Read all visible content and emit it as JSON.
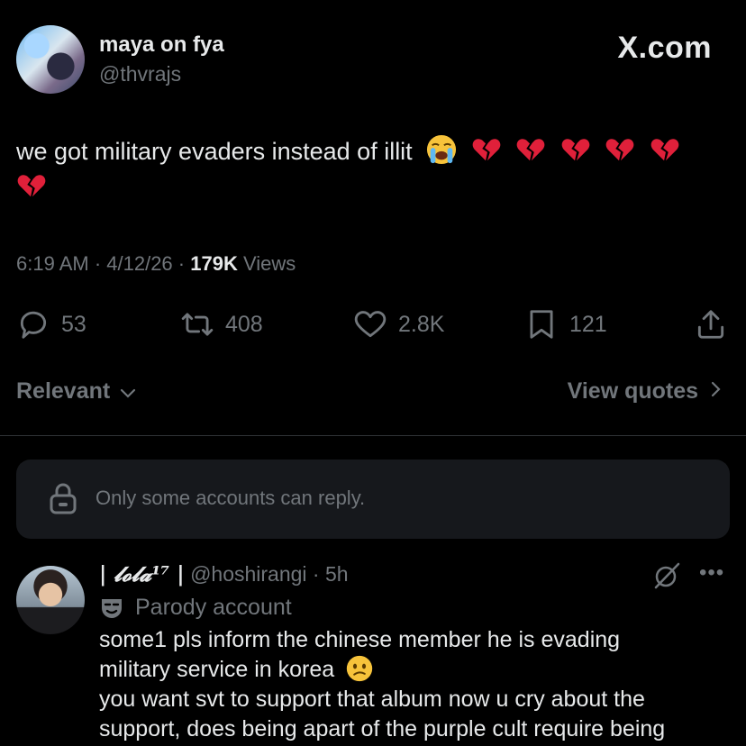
{
  "watermark": "X.com",
  "post": {
    "display_name": "maya on fya",
    "handle": "@thvrajs",
    "text": "we got military evaders instead of illit",
    "emojis": [
      "loudly-crying-face",
      "broken-heart",
      "broken-heart",
      "broken-heart",
      "broken-heart",
      "broken-heart",
      "broken-heart"
    ],
    "time": "6:19 AM · 4/12/26 · ",
    "views_count": "179K",
    "views_label": "Views",
    "stats": {
      "replies": "53",
      "reposts": "408",
      "likes": "2.8K",
      "bookmarks": "121"
    }
  },
  "filters": {
    "sort_label": "Relevant",
    "view_quotes_label": "View quotes"
  },
  "reply_restriction": "Only some accounts can reply.",
  "reply": {
    "display_name": "| 𝓵𝓸𝓵𝓪¹⁷ |",
    "handle_time": "@hoshirangi · 5h",
    "badge_label": "Parody account",
    "line1": "some1 pls inform the chinese member he is evading",
    "line2": "military service in korea",
    "line3": "you want svt to support that album now u cry about the",
    "line4": "support, does being apart of the purple cult require being"
  },
  "colors": {
    "background": "#000000",
    "text_primary": "#e7e9ea",
    "text_secondary": "#71767b",
    "divider": "#2f3336",
    "box": "#16181c",
    "broken_heart": "#e0203a"
  }
}
